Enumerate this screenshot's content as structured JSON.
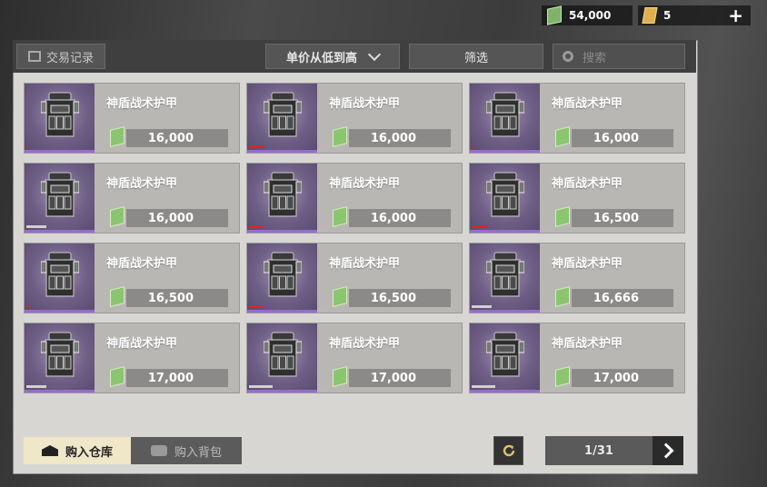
{
  "currency": {
    "money": "54,000",
    "coupons": "5",
    "add_icon": "plus-icon"
  },
  "toolbar": {
    "record_label": "交易记录",
    "sort_label": "单价从低到高",
    "filter_label": "筛选",
    "search_placeholder": "搜索"
  },
  "listings": [
    {
      "name": "神盾战术护甲",
      "price": "16,000",
      "durability": 0.02,
      "status_color": "#c23030"
    },
    {
      "name": "神盾战术护甲",
      "price": "16,000",
      "durability": 0.25,
      "status_color": "#c23030"
    },
    {
      "name": "神盾战术护甲",
      "price": "16,000",
      "durability": 0.02,
      "status_color": "#c23030"
    },
    {
      "name": "神盾战术护甲",
      "price": "16,000",
      "durability": 0.3,
      "status_color": "#d0d0d0"
    },
    {
      "name": "神盾战术护甲",
      "price": "16,000",
      "durability": 0.2,
      "status_color": "#c23030"
    },
    {
      "name": "神盾战术护甲",
      "price": "16,500",
      "durability": 0.25,
      "status_color": "#c23030"
    },
    {
      "name": "神盾战术护甲",
      "price": "16,500",
      "durability": 0.05,
      "status_color": "#c23030"
    },
    {
      "name": "神盾战术护甲",
      "price": "16,500",
      "durability": 0.2,
      "status_color": "#c23030"
    },
    {
      "name": "神盾战术护甲",
      "price": "16,666",
      "durability": 0.3,
      "status_color": "#d0d0d0"
    },
    {
      "name": "神盾战术护甲",
      "price": "17,000",
      "durability": 0.3,
      "status_color": "#d0d0d0"
    },
    {
      "name": "神盾战术护甲",
      "price": "17,000",
      "durability": 0.35,
      "status_color": "#d0d0d0"
    },
    {
      "name": "神盾战术护甲",
      "price": "17,000",
      "durability": 0.35,
      "status_color": "#d0d0d0"
    }
  ],
  "bottom": {
    "buy_to_warehouse": "购入仓库",
    "buy_to_bag": "购入背包",
    "page": "1/31"
  }
}
